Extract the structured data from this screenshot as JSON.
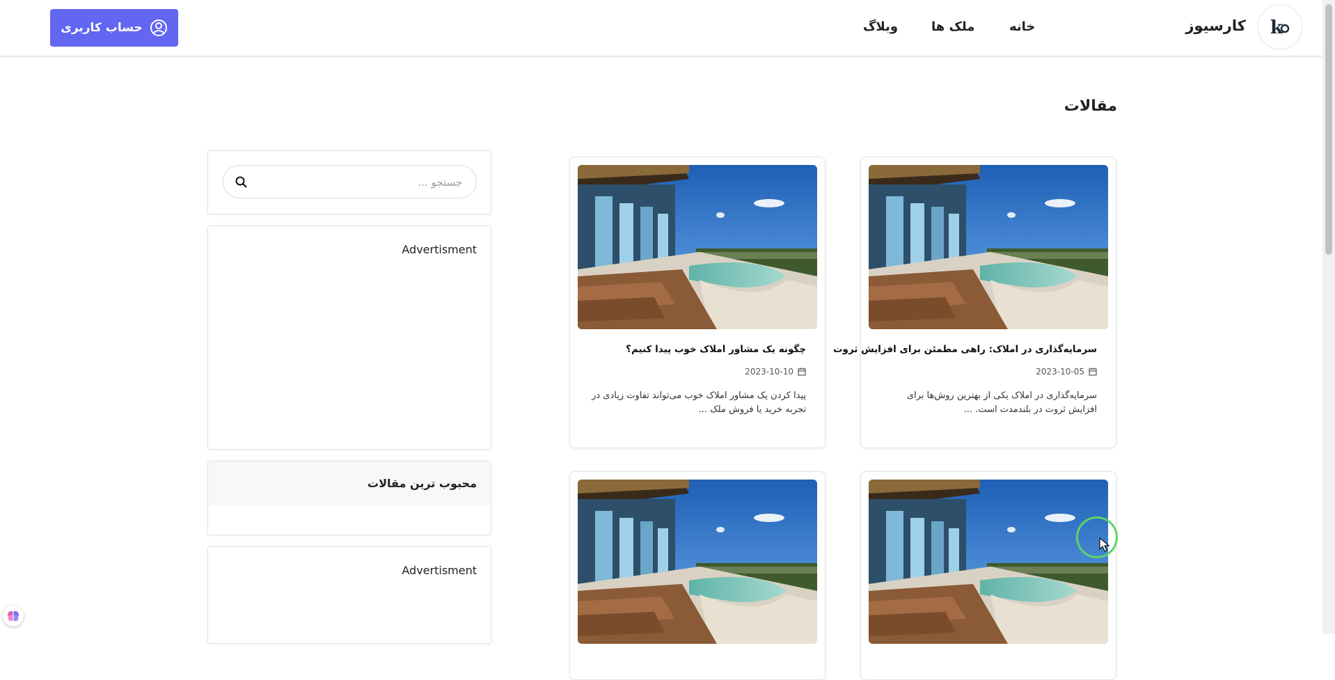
{
  "header": {
    "brand": "کارسیوز",
    "nav": [
      "خانه",
      "ملک ها",
      "وبلاگ"
    ],
    "account_label": "حساب کاربری"
  },
  "page": {
    "title": "مقالات"
  },
  "sidebar": {
    "search_placeholder": "جستجو ...",
    "ad_label_1": "Advertisment",
    "popular_title": "محبوب ترین مقالات",
    "ad_label_2": "Advertisment"
  },
  "articles": [
    {
      "title": "سرمایه‌گذاری در املاک: راهی مطمئن برای افزایش ثروت",
      "date": "2023-10-05",
      "excerpt": "سرمایه‌گذاری در املاک یکی از بهترین روش‌ها برای افزایش ثروت در بلندمدت است. ..."
    },
    {
      "title": "چگونه یک مشاور املاک خوب پیدا کنیم؟",
      "date": "2023-10-10",
      "excerpt": "پیدا کردن یک مشاور املاک خوب می‌تواند تفاوت زیادی در تجربه خرید یا فروش ملک ..."
    }
  ],
  "colors": {
    "accent": "#6366f1",
    "cursor_ring": "#5bd46a"
  }
}
